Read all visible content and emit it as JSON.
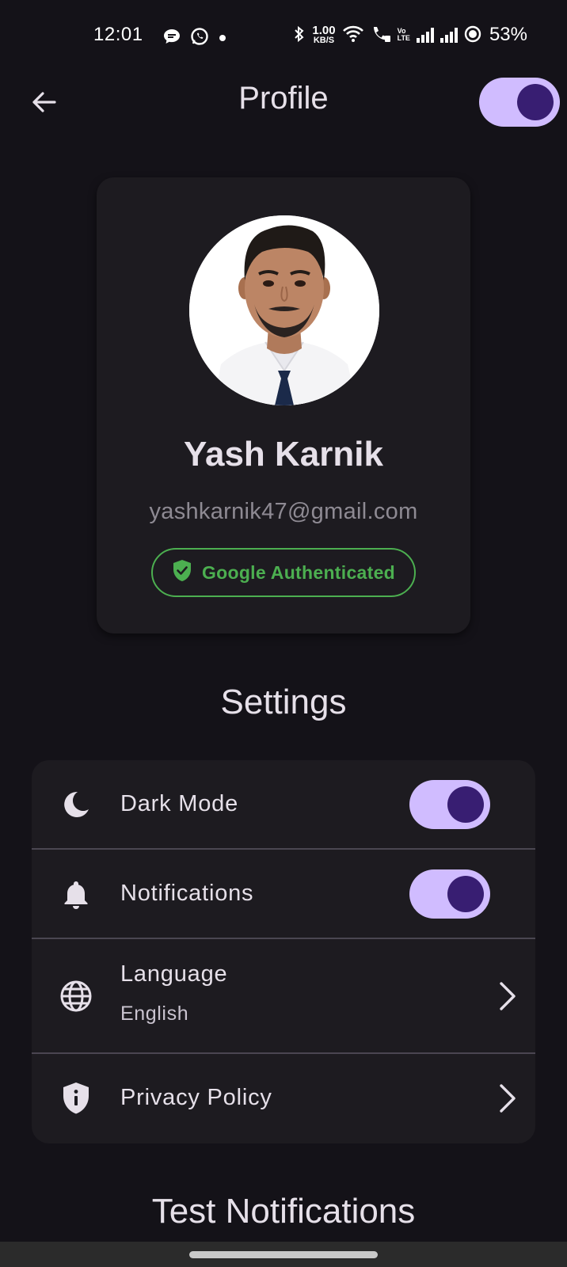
{
  "status_bar": {
    "time": "12:01",
    "net_speed_value": "1.00",
    "net_speed_unit": "KB/S",
    "volte_top": "Vo",
    "volte_bottom": "LTE",
    "battery": "53%"
  },
  "app_bar": {
    "title": "Profile",
    "back_icon": "arrow-back-icon",
    "theme_toggle_on": true
  },
  "profile": {
    "name": "Yash Karnik",
    "email": "yashkarnik47@gmail.com",
    "badge_label": "Google Authenticated",
    "badge_icon": "verified-shield-icon",
    "badge_color": "#4CAF50"
  },
  "settings": {
    "title": "Settings",
    "items": [
      {
        "label": "Dark Mode",
        "icon": "moon-icon",
        "type": "switch",
        "on": true
      },
      {
        "label": "Notifications",
        "icon": "bell-icon",
        "type": "switch",
        "on": true
      },
      {
        "label": "Language",
        "sublabel": "English",
        "icon": "globe-icon",
        "type": "link"
      },
      {
        "label": "Privacy Policy",
        "icon": "privacy-shield-icon",
        "type": "link"
      }
    ]
  },
  "test_notifications": {
    "title": "Test Notifications"
  },
  "colors": {
    "background": "#141218",
    "surface": "#1D1B20",
    "switch_track": "#D0BCFF",
    "switch_thumb": "#381E72",
    "text_primary": "#E6E0E9",
    "text_secondary": "#8E8A93"
  }
}
